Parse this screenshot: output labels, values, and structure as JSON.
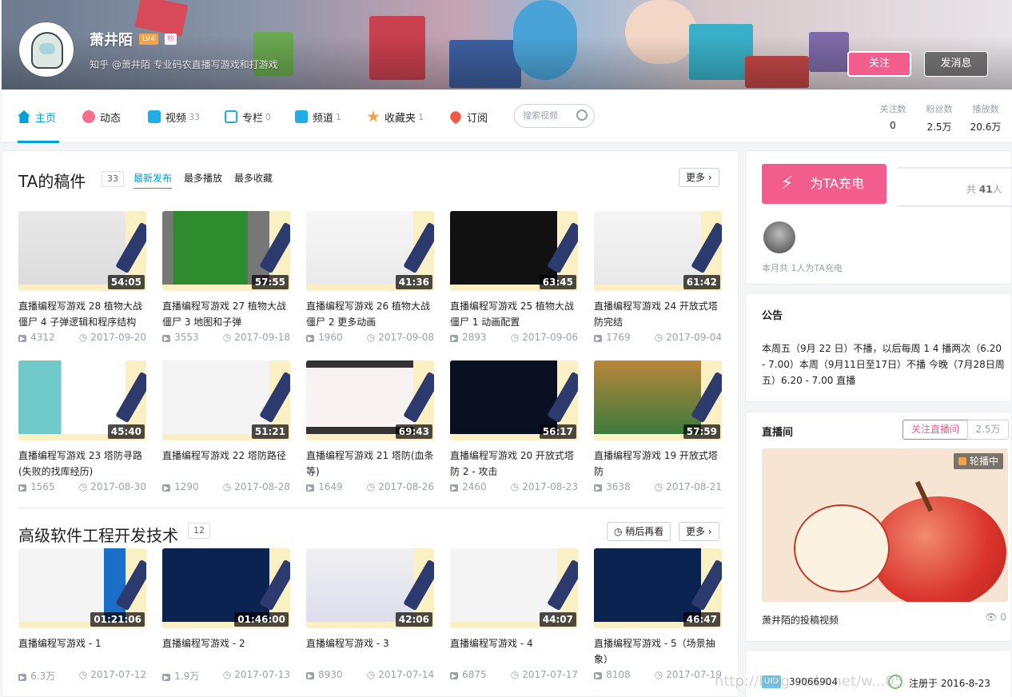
{
  "header": {
    "username": "萧井陌",
    "level": "LV4",
    "badge": "粉",
    "signature": "知乎 @萧井陌 专业码农直播写游戏和打游戏",
    "follow_label": "关注",
    "message_label": "发消息"
  },
  "nav": {
    "items": [
      {
        "label": "主页",
        "count": "",
        "icon": "home-icon"
      },
      {
        "label": "动态",
        "count": "",
        "icon": "activity-icon"
      },
      {
        "label": "视频",
        "count": "33",
        "icon": "video-icon"
      },
      {
        "label": "专栏",
        "count": "0",
        "icon": "column-icon"
      },
      {
        "label": "频道",
        "count": "1",
        "icon": "channel-icon"
      },
      {
        "label": "收藏夹",
        "count": "1",
        "icon": "star-icon"
      },
      {
        "label": "订阅",
        "count": "",
        "icon": "heart-icon"
      }
    ],
    "search_placeholder": "搜索视频",
    "stats": [
      {
        "label": "关注数",
        "value": "0"
      },
      {
        "label": "粉丝数",
        "value": "2.5万"
      },
      {
        "label": "播放数",
        "value": "20.6万"
      }
    ]
  },
  "uploads": {
    "title": "TA的稿件",
    "count": "33",
    "tabs": [
      "最新发布",
      "最多播放",
      "最多收藏"
    ],
    "more": "更多",
    "videos": [
      {
        "title": "直播编程写游戏 28 植物大战僵尸 4 子弹逻辑和程序结构",
        "duration": "54:05",
        "plays": "4312",
        "date": "2017-09-20"
      },
      {
        "title": "直播编程写游戏 27 植物大战僵尸 3 地图和子弹",
        "duration": "57:55",
        "plays": "3553",
        "date": "2017-09-18"
      },
      {
        "title": "直播编程写游戏 26 植物大战僵尸 2 更多动画",
        "duration": "41:36",
        "plays": "1960",
        "date": "2017-09-08"
      },
      {
        "title": "直播编程写游戏 25 植物大战僵尸 1 动画配置",
        "duration": "63:45",
        "plays": "2893",
        "date": "2017-09-06"
      },
      {
        "title": "直播编程写游戏 24 开放式塔防完结",
        "duration": "61:42",
        "plays": "1769",
        "date": "2017-09-04"
      },
      {
        "title": "直播编程写游戏 23 塔防寻路(失败的找库经历)",
        "duration": "45:40",
        "plays": "1565",
        "date": "2017-08-30"
      },
      {
        "title": "直播编程写游戏 22 塔防路径",
        "duration": "51:21",
        "plays": "1290",
        "date": "2017-08-28"
      },
      {
        "title": "直播编程写游戏 21 塔防(血条等)",
        "duration": "69:43",
        "plays": "1649",
        "date": "2017-08-26"
      },
      {
        "title": "直播编程写游戏 20 开放式塔防 2 - 攻击",
        "duration": "56:17",
        "plays": "2460",
        "date": "2017-08-23"
      },
      {
        "title": "直播编程写游戏 19 开放式塔防",
        "duration": "57:59",
        "plays": "3638",
        "date": "2017-08-21"
      }
    ]
  },
  "playlist": {
    "title": "高级软件工程开发技术",
    "count": "12",
    "watch_later": "稍后再看",
    "more": "更多",
    "videos": [
      {
        "title": "直播编程写游戏 - 1",
        "duration": "01:21:06",
        "plays": "6.3万",
        "date": "2017-07-12"
      },
      {
        "title": "直播编程写游戏 - 2",
        "duration": "01:46:00",
        "plays": "1.9万",
        "date": "2017-07-13"
      },
      {
        "title": "直播编程写游戏 - 3",
        "duration": "42:06",
        "plays": "8930",
        "date": "2017-07-14"
      },
      {
        "title": "直播编程写游戏 - 4",
        "duration": "44:07",
        "plays": "6875",
        "date": "2017-07-17"
      },
      {
        "title": "直播编程写游戏 - 5（场景抽象）",
        "duration": "46:47",
        "plays": "8108",
        "date": "2017-07-19"
      }
    ]
  },
  "charge": {
    "button": "为TA充电",
    "total_prefix": "共",
    "total_value": "41",
    "total_suffix": "人",
    "month_text": "本月共 1人为TA充电"
  },
  "notice": {
    "title": "公告",
    "text": "本周五（9月 22 日）不播，以后每周 1 4 播两次（6.20 - 7.00）本周（9月11日至17日）不播 今晚（7月28日周五）6.20 - 7.00 直播"
  },
  "live": {
    "title": "直播间",
    "follow_label": "关注直播间",
    "follow_count": "2.5万",
    "status": "轮播中",
    "caption": "萧井陌的投稿视频",
    "views": "0"
  },
  "profile": {
    "uid_label": "UID",
    "uid": "39066904",
    "register": "注册于 2016-8-23"
  },
  "watermark": "http://blog.csdn.net/w...05"
}
